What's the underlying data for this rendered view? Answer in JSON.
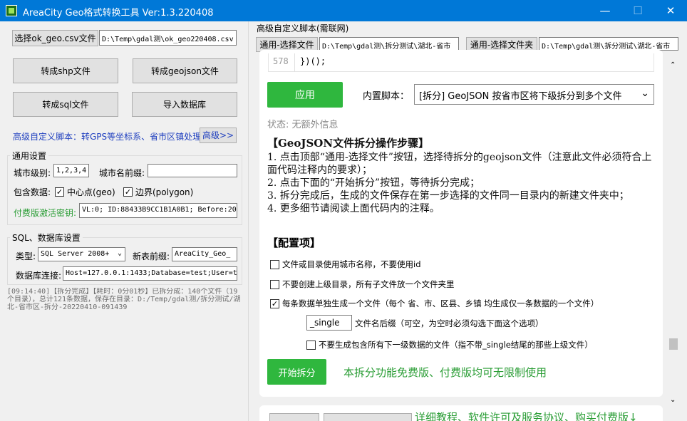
{
  "window": {
    "title": "AreaCity Geo格式转换工具 Ver:1.3.220408",
    "minimize": "—",
    "maximize": "☐",
    "close": "✕"
  },
  "left": {
    "select_csv_button": "选择ok_geo.csv文件",
    "csv_path": "D:\\Temp\\gdal测\\ok_geo220408.csv",
    "to_shp": "转成shp文件",
    "to_geojson": "转成geojson文件",
    "to_sql": "转成sql文件",
    "import_db": "导入数据库",
    "advanced_text": "高级自定义脚本：转GPS等坐标系、省市区镇处理",
    "advanced_button": "高级>>",
    "general": {
      "title": "通用设置",
      "level_label": "城市级别:",
      "level_value": "1,2,3,4",
      "prefix_label": "城市名前缀:",
      "prefix_value": "",
      "include_label": "包含数据:",
      "center_checked": "✓",
      "center_label": "中心点(geo)",
      "polygon_checked": "✓",
      "polygon_label": "边界(polygon)",
      "paid_label": "付费版激活密钥:",
      "paid_value": "VL:0; ID:88433B9CC1B1A0B1; Before:20"
    },
    "db": {
      "title": "SQL、数据库设置",
      "type_label": "类型:",
      "type_value": "SQL Server 2008+",
      "table_prefix_label": "新表前缀:",
      "table_prefix_value": "AreaCity_Geo_",
      "conn_label": "数据库连接:",
      "conn_value": "Host=127.0.0.1:1433;Database=test;User=t"
    },
    "log": "[09:14:40]【拆分完成】【耗时：0分01秒】已拆分成：140个文件（19个目录），总计121条数据，保存在目录：D:/Temp/gdal测/拆分测试/湖北-省市区-拆分-20220410-091439"
  },
  "right": {
    "header": "高级自定义脚本(需联网)",
    "general_select_file": "通用-选择文件",
    "file_path": "D:\\Temp\\gdal测\\拆分测试\\湖北-省市",
    "general_select_folder": "通用-选择文件夹",
    "folder_path": "D:\\Temp\\gdal测\\拆分测试\\湖北-省市",
    "code_line_no": "578",
    "code_line": "})();",
    "apply_button": "应用",
    "builtin_label": "内置脚本：",
    "builtin_value": "[拆分] GeoJSON 按省市区将下级拆分到多个文件",
    "status": "状态: 无额外信息",
    "doc_title": "【GeoJSON文件拆分操作步骤】",
    "steps": [
      "1. 点击顶部“通用-选择文件”按钮，选择待拆分的geojson文件（注意此文件必须符合上面代码注释内的要求）；",
      "2. 点击下面的“开始拆分”按钮，等待拆分完成；",
      "3. 拆分完成后，生成的文件保存在第一步选择的文件同一目录内的新建文件夹中；",
      "4. 更多细节请阅读上面代码内的注释。"
    ],
    "config_title": "【配置项】",
    "opt1": "文件或目录使用城市名称，不要使用id",
    "opt2": "不要创建上级目录，所有子文件放一个文件夹里",
    "opt3_checked": "✓",
    "opt3": "每条数据单独生成一个文件（每个 省、市、区县、乡镇 均生成仅一条数据的一个文件）",
    "suffix_value": "_single",
    "suffix_label": "文件名后缀（可空，为空时必须勾选下面这个选项）",
    "opt4": "不要生成包含所有下一级数据的文件（指不带_single结尾的那些上级文件）",
    "start_button": "开始拆分",
    "free_note": "本拆分功能免费版、付费版均可无限制使用",
    "bottom_link": "详细教程、软件许可及服务协议、购买付费版↓"
  }
}
